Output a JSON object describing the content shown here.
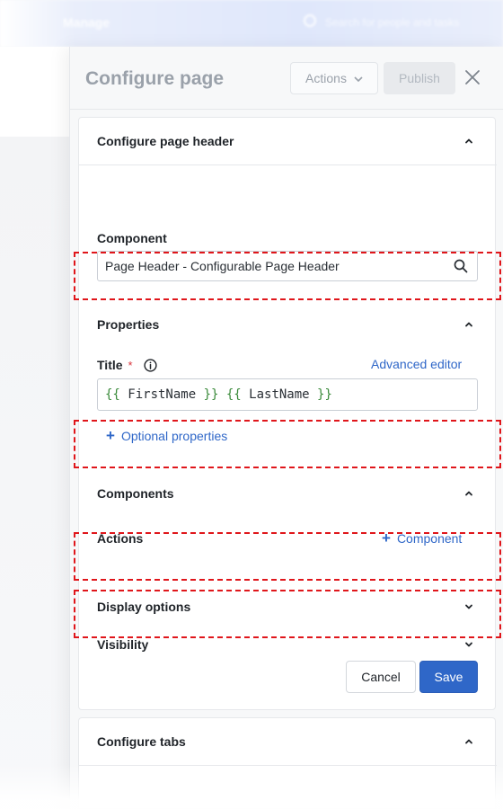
{
  "background": {
    "app_title": "Manage",
    "search_placeholder": "Search for people and tasks"
  },
  "drawer": {
    "title": "Configure page",
    "actions_label": "Actions",
    "publish_label": "Publish",
    "close_icon": "close-icon"
  },
  "sections": {
    "page_header": {
      "label": "Configure page header",
      "component_label": "Component",
      "component_value": "Page Header - Configurable Page Header"
    },
    "properties": {
      "label": "Properties",
      "title_label": "Title",
      "required_mark": "*",
      "advanced_editor_label": "Advanced editor",
      "title_value": {
        "open1": "{{",
        "field1": " FirstName ",
        "close1": "}}",
        "open2": "{{",
        "field2": " LastName ",
        "close2": "}}"
      },
      "optional_properties_label": "Optional properties"
    },
    "components": {
      "label": "Components",
      "actions_label": "Actions",
      "add_component_label": "Component"
    },
    "display_options": {
      "label": "Display options"
    },
    "visibility": {
      "label": "Visibility"
    }
  },
  "footer": {
    "cancel_label": "Cancel",
    "save_label": "Save"
  },
  "tabs_section": {
    "label": "Configure tabs"
  },
  "colors": {
    "primary": "#2f67c8",
    "highlight_dashed": "#e0161b",
    "required": "#d9363e",
    "template_brace": "#3a8a3a"
  },
  "icons": [
    "search-icon",
    "info-icon",
    "chevron-up-icon",
    "chevron-down-icon",
    "close-icon",
    "plus-icon"
  ]
}
